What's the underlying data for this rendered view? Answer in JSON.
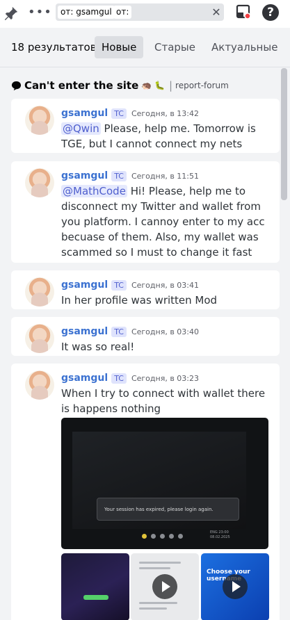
{
  "topbar": {
    "search": {
      "chip_prefix": "от:",
      "chip_user": "gsamgul",
      "chip2_prefix": "от:"
    }
  },
  "results": {
    "count": "18 результатов",
    "tabs": [
      "Новые",
      "Старые",
      "Актуальные"
    ],
    "selected_tab": "Новые"
  },
  "thread": {
    "title": "Can't enter the site",
    "emojis": "🦔 🐛",
    "separator": "|",
    "forum": "report-forum"
  },
  "messages": [
    {
      "author": "gsamgul",
      "tag": "TC",
      "time": "Сегодня, в 13:42",
      "mention": "@Qwin",
      "text": " Please, help me. Tomorrow is TGE, but I cannot connect my nets"
    },
    {
      "author": "gsamgul",
      "tag": "TC",
      "time": "Сегодня, в 11:51",
      "mention": "@MathCode",
      "text": " Hi! Please, help me to disconnect my Twitter and wallet from you platform. I cannoy enter to my acc becuase of them. Also, my wallet was scammed so I must to change it fast"
    },
    {
      "author": "gsamgul",
      "tag": "TC",
      "time": "Сегодня, в 03:41",
      "text": "In her profile was written Mod"
    },
    {
      "author": "gsamgul",
      "tag": "TC",
      "time": "Сегодня, в 03:40",
      "text": "It was so real!"
    },
    {
      "author": "gsamgul",
      "tag": "TC",
      "time": "Сегодня, в 03:23",
      "text": "When I try to connect with wallet there is happens nothing",
      "media": {
        "photo_toast": "Your session has expired, please login again.",
        "photo_clock": "23:00",
        "photo_date": "08.02.2025",
        "photo_lang": "ENG",
        "thumb3_text": "Choose your username"
      }
    }
  ],
  "colors": {
    "author": "#3c72d1",
    "mention_bg": "#e5e9fd",
    "card_bg": "#ffffff",
    "page_bg": "#f2f3f5"
  }
}
